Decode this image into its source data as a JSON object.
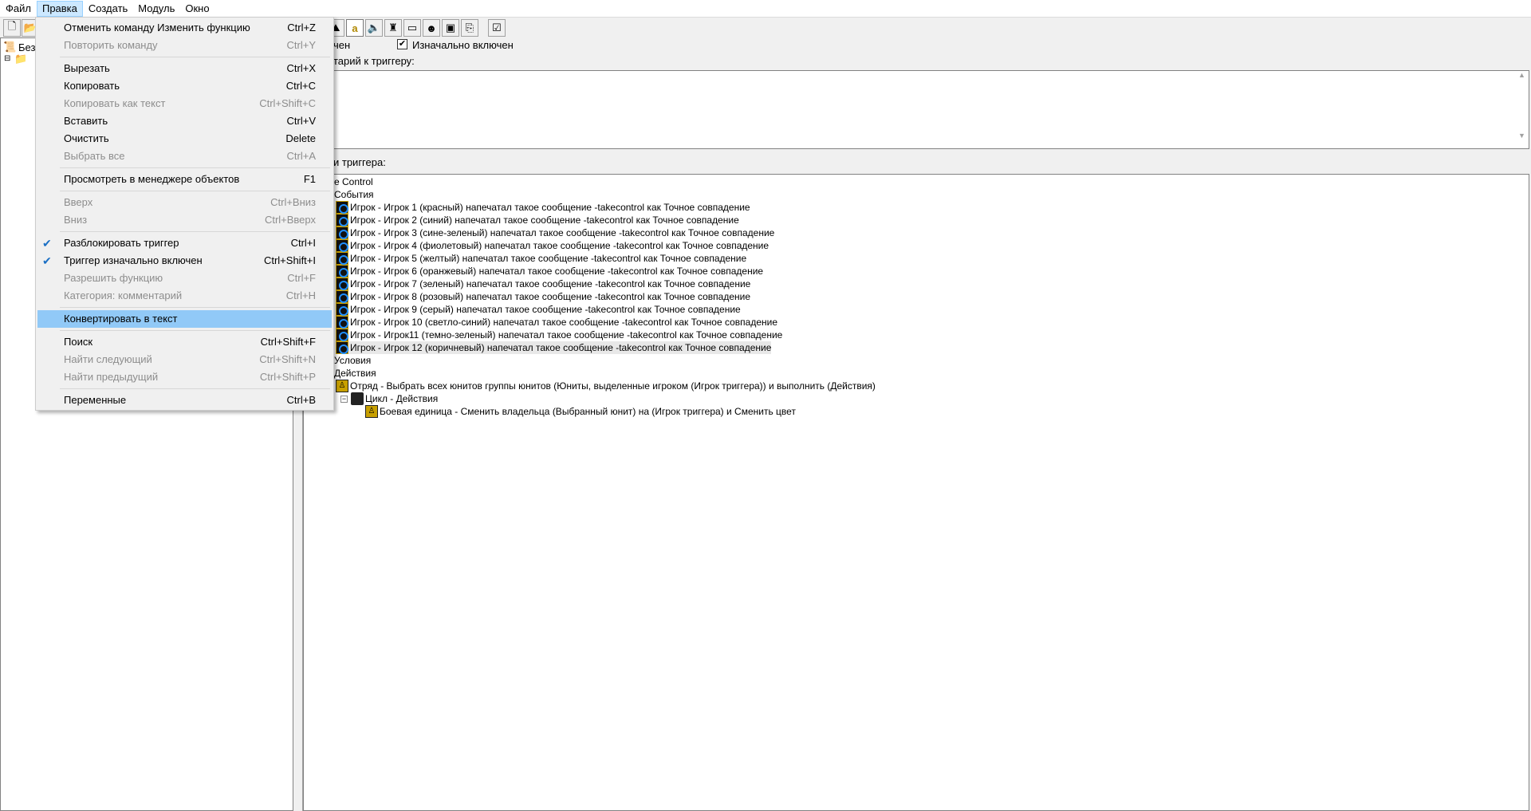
{
  "menubar": [
    "Файл",
    "Правка",
    "Создать",
    "Модуль",
    "Окно"
  ],
  "toolbar": {
    "left_icons": [
      "new-icon",
      "open-icon"
    ],
    "right_icons": [
      "terrain-icon",
      "text-icon",
      "sound-icon",
      "unit-icon",
      "panel-icon",
      "ai-icon",
      "object-icon",
      "import-icon",
      "test-map-icon"
    ]
  },
  "left_tree": {
    "root": "Без"
  },
  "trigger": {
    "enabled_fragment": "чен",
    "initially_enabled_label": "Изначально включен",
    "initially_enabled": true,
    "comment_label_fragment": "тарий к триггеру:",
    "functions_label_fragment": "и триггера:"
  },
  "tree": {
    "name_fragment": "e Control",
    "events": "События",
    "conditions": "Условия",
    "actions": "Действия",
    "event_rows": [
      "Игрок - Игрок 1 (красный) напечатал такое сообщение -takecontrol как Точное совпадение",
      "Игрок - Игрок 2 (синий) напечатал такое сообщение -takecontrol как Точное совпадение",
      "Игрок - Игрок 3 (сине-зеленый) напечатал такое сообщение -takecontrol как Точное совпадение",
      "Игрок - Игрок 4 (фиолетовый) напечатал такое сообщение -takecontrol как Точное совпадение",
      "Игрок - Игрок 5 (желтый) напечатал такое сообщение -takecontrol как Точное совпадение",
      "Игрок - Игрок 6 (оранжевый) напечатал такое сообщение -takecontrol как Точное совпадение",
      "Игрок - Игрок 7 (зеленый) напечатал такое сообщение -takecontrol как Точное совпадение",
      "Игрок - Игрок 8 (розовый) напечатал такое сообщение -takecontrol как Точное совпадение",
      "Игрок - Игрок 9 (серый) напечатал такое сообщение -takecontrol как Точное совпадение",
      "Игрок - Игрок 10 (светло-синий) напечатал такое сообщение -takecontrol как Точное совпадение",
      "Игрок - Игрок11 (темно-зеленый) напечатал такое сообщение -takecontrol как Точное совпадение",
      "Игрок - Игрок 12 (коричневый) напечатал такое сообщение -takecontrol как Точное совпадение"
    ],
    "action_group": "Отряд - Выбрать всех юнитов группы юнитов (Юниты, выделенные игроком (Игрок триггера)) и выполнить (Действия)",
    "loop": "Цикл - Действия",
    "loop_action": "Боевая единица - Сменить владельца (Выбранный юнит) на (Игрок триггера) и Сменить цвет"
  },
  "edit_menu": [
    {
      "label": "Отменить команду Изменить функцию",
      "shortcut": "Ctrl+Z"
    },
    {
      "label": "Повторить команду",
      "shortcut": "Ctrl+Y",
      "disabled": true
    },
    {
      "sep": true
    },
    {
      "label": "Вырезать",
      "shortcut": "Ctrl+X"
    },
    {
      "label": "Копировать",
      "shortcut": "Ctrl+C"
    },
    {
      "label": "Копировать как текст",
      "shortcut": "Ctrl+Shift+C",
      "disabled": true
    },
    {
      "label": "Вставить",
      "shortcut": "Ctrl+V"
    },
    {
      "label": "Очистить",
      "shortcut": "Delete"
    },
    {
      "label": "Выбрать все",
      "shortcut": "Ctrl+A",
      "disabled": true
    },
    {
      "sep": true
    },
    {
      "label": "Просмотреть в менеджере объектов",
      "shortcut": "F1"
    },
    {
      "sep": true
    },
    {
      "label": "Вверх",
      "shortcut": "Ctrl+Вниз",
      "disabled": true
    },
    {
      "label": "Вниз",
      "shortcut": "Ctrl+Вверх",
      "disabled": true
    },
    {
      "sep": true
    },
    {
      "label": "Разблокировать триггер",
      "shortcut": "Ctrl+I",
      "checked": true
    },
    {
      "label": "Триггер изначально включен",
      "shortcut": "Ctrl+Shift+I",
      "checked": true
    },
    {
      "label": "Разрешить функцию",
      "shortcut": "Ctrl+F",
      "disabled": true
    },
    {
      "label": "Категория: комментарий",
      "shortcut": "Ctrl+H",
      "disabled": true
    },
    {
      "sep": true
    },
    {
      "label": "Конвертировать в текст",
      "shortcut": "",
      "highlighted": true
    },
    {
      "sep": true
    },
    {
      "label": "Поиск",
      "shortcut": "Ctrl+Shift+F"
    },
    {
      "label": "Найти следующий",
      "shortcut": "Ctrl+Shift+N",
      "disabled": true
    },
    {
      "label": "Найти предыдущий",
      "shortcut": "Ctrl+Shift+P",
      "disabled": true
    },
    {
      "sep": true
    },
    {
      "label": "Переменные",
      "shortcut": "Ctrl+B"
    }
  ]
}
